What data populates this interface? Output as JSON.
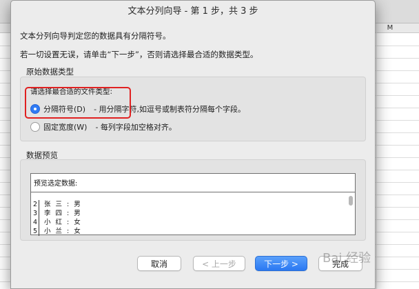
{
  "window": {
    "title": "文本分列向导 - 第 1 步，共 3 步"
  },
  "intro": {
    "line1": "文本分列向导判定您的数据具有分隔符号。",
    "line2": "若一切设置无误，请单击“下一步”，否则请选择最合适的数据类型。"
  },
  "original_data_type": {
    "group_title": "原始数据类型",
    "file_type_label": "请选择最合适的文件类型:",
    "options": [
      {
        "label": "分隔符号(D)",
        "description": "- 用分隔字符,如逗号或制表符分隔每个字段。",
        "selected": true
      },
      {
        "label": "固定宽度(W)",
        "description": "- 每列字段加空格对齐。",
        "selected": false
      }
    ]
  },
  "data_preview": {
    "group_title": "数据预览",
    "header": "预览选定数据:",
    "rows": [
      {
        "num": "2",
        "text": "张 三 :  男"
      },
      {
        "num": "3",
        "text": "李 四 :  男"
      },
      {
        "num": "4",
        "text": "小 红 :  女"
      },
      {
        "num": "5",
        "text": "小 兰 :  女"
      }
    ]
  },
  "buttons": {
    "cancel": "取消",
    "back": "< 上一步",
    "next": "下一步 >",
    "finish": "完成"
  },
  "spreadsheet": {
    "visible_column": "M"
  },
  "watermark": "Bai 经验",
  "colors": {
    "accent": "#2f7bf5",
    "highlight": "#e02020"
  }
}
